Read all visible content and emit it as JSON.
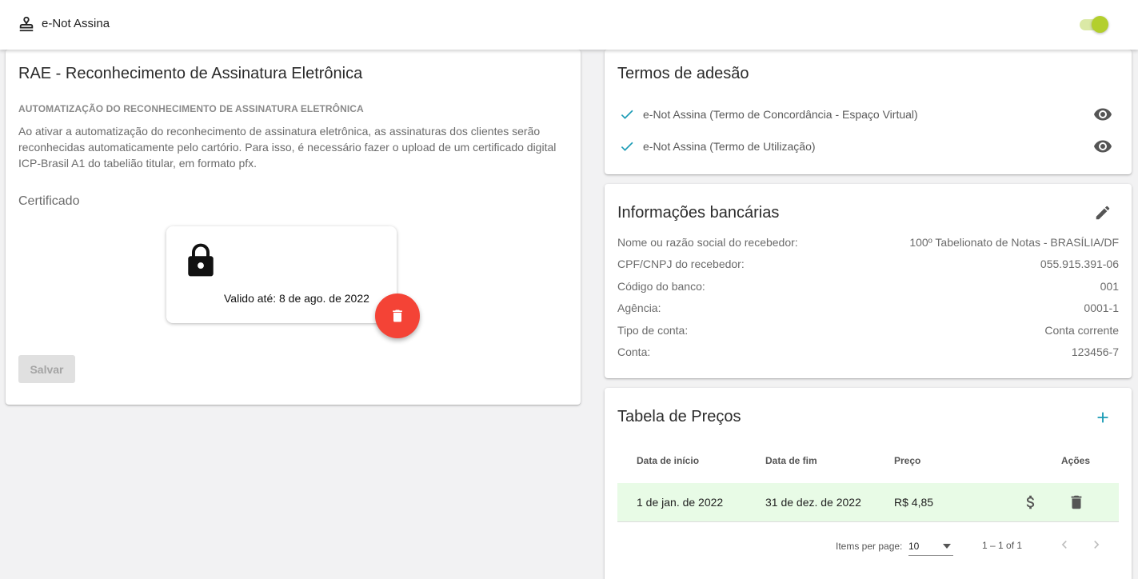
{
  "toolbar": {
    "title": "e-Not Assina",
    "brand_icon": "stamp-icon",
    "toggle_on": true,
    "accent_color": "#b3cf2d"
  },
  "rae": {
    "title": "RAE - Reconhecimento de Assinatura Eletrônica",
    "section_label": "AUTOMATIZAÇÃO DO RECONHECIMENTO DE ASSINATURA ELETRÔNICA",
    "description": "Ao ativar a automatização do reconhecimento de assinatura eletrônica, as assinaturas dos clientes serão reconhecidas automaticamente pelo cartório. Para isso, é necessário fazer o upload de um certificado digital ICP-Brasil A1 do tabelião titular, em formato pfx.",
    "certificate_label": "Certificado",
    "certificate_valid": "Valido até: 8 de ago. de 2022",
    "save_label": "Salvar",
    "delete_color": "#f44336"
  },
  "terms": {
    "title": "Termos de adesão",
    "items": [
      {
        "label": "e-Not Assina (Termo de Concordância - Espaço Virtual)"
      },
      {
        "label": "e-Not Assina (Termo de Utilização)"
      }
    ],
    "check_color": "#1a9bb5"
  },
  "bank": {
    "title": "Informações bancárias",
    "rows": [
      {
        "label": "Nome ou razão social do recebedor:",
        "value": "100º Tabelionato de Notas - BRASÍLIA/DF"
      },
      {
        "label": "CPF/CNPJ do recebedor:",
        "value": "055.915.391-06"
      },
      {
        "label": "Código do banco:",
        "value": "001"
      },
      {
        "label": "Agência:",
        "value": "0001-1"
      },
      {
        "label": "Tipo de conta:",
        "value": "Conta corrente"
      },
      {
        "label": "Conta:",
        "value": "123456-7"
      }
    ]
  },
  "prices": {
    "title": "Tabela de Preços",
    "columns": [
      "Data de início",
      "Data de fim",
      "Preço",
      "Ações"
    ],
    "rows": [
      {
        "start": "1 de jan. de 2022",
        "end": "31 de dez. de 2022",
        "price": "R$ 4,85"
      }
    ],
    "row_color": "#e8fbe6",
    "paginator": {
      "items_per_page_label": "Items per page:",
      "items_per_page": "10",
      "range": "1 – 1 of 1"
    }
  }
}
